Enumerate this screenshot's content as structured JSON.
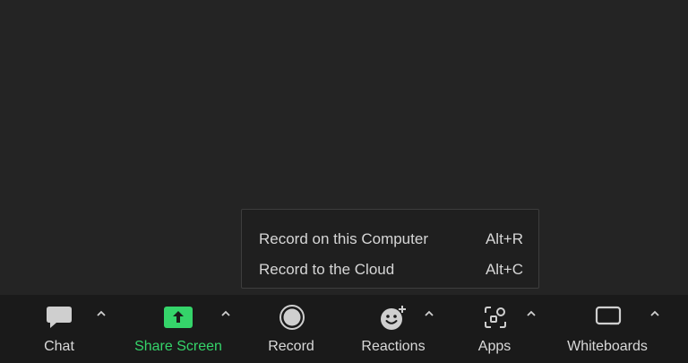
{
  "menu": {
    "items": [
      {
        "label": "Record on this Computer",
        "shortcut": "Alt+R"
      },
      {
        "label": "Record to the Cloud",
        "shortcut": "Alt+C"
      }
    ]
  },
  "toolbar": {
    "chat_label": "Chat",
    "share_label": "Share Screen",
    "record_label": "Record",
    "reactions_label": "Reactions",
    "apps_label": "Apps",
    "whiteboards_label": "Whiteboards"
  },
  "colors": {
    "accent_green": "#35d46a",
    "icon_gray": "#cfcfcf",
    "toolbar_bg": "#1a1a1a",
    "menu_bg": "#1f1f1f"
  },
  "icons": {
    "chat": "chat-bubble-icon",
    "share": "share-screen-arrow-icon",
    "record": "record-circle-icon",
    "reactions": "smiley-plus-icon",
    "apps": "apps-grid-icon",
    "whiteboards": "whiteboard-icon",
    "caret": "chevron-up-icon"
  }
}
